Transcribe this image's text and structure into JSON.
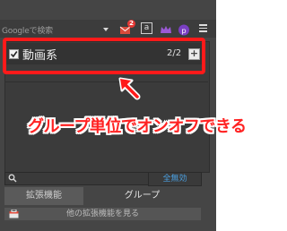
{
  "toolbar": {
    "search_placeholder": "Googleで検索",
    "mail_badge_count": "2",
    "a_icon_label": "a"
  },
  "group": {
    "name": "動画系",
    "count": "2/2",
    "add_label": "+"
  },
  "annotation": {
    "text": "グループ単位でオンオフできる",
    "color": "#ff2222"
  },
  "footer": {
    "disable_all_label": "全無効",
    "tabs": [
      "拡張機能",
      "グループ"
    ],
    "more_extensions_label": "他の拡張機能を見る"
  }
}
